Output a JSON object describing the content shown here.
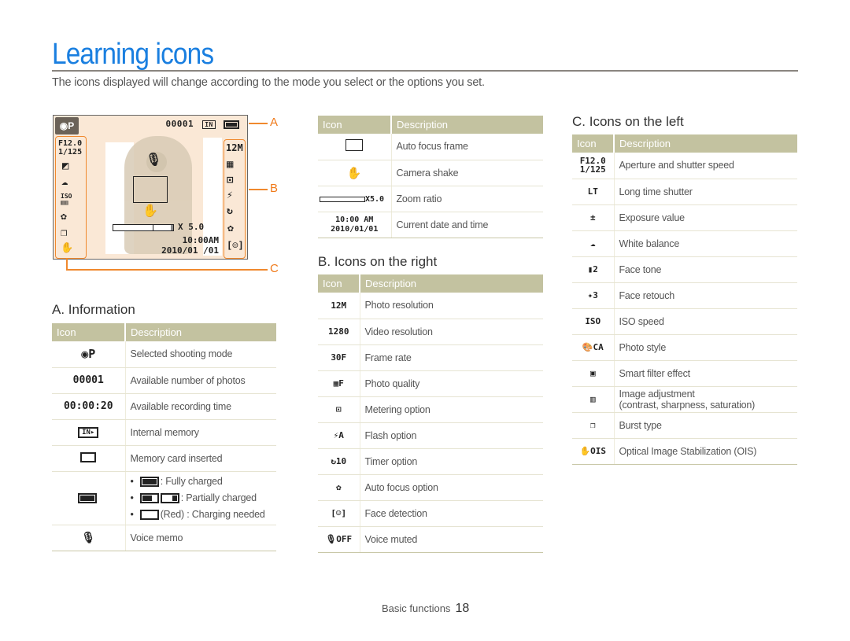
{
  "page": {
    "title": "Learning icons",
    "subtitle": "The icons displayed will change according to the mode you select or the options you set.",
    "accent_color": "#1a7fe0",
    "callout_color": "#f0892e",
    "table_header_color": "#c3c2a0"
  },
  "screen": {
    "mode_icon": "camera-program-icon",
    "photo_count": "00001",
    "memory": "IN",
    "aperture": "F12.0",
    "shutter": "1/125",
    "zoom": "X 5.0",
    "time": "10:00AM",
    "date": "2010/01 /01",
    "res": "12M",
    "labels": {
      "a": "A",
      "b": "B",
      "c": "C"
    }
  },
  "section_a": {
    "title": "A. Information",
    "header": {
      "icon": "Icon",
      "description": "Description"
    },
    "rows": [
      {
        "icon": "camera-program-icon",
        "icon_text": "📷P",
        "description": "Selected shooting mode"
      },
      {
        "icon": "photo-count-icon",
        "icon_text": "00001",
        "description": "Available number of photos"
      },
      {
        "icon": "recording-time-icon",
        "icon_text": "00:00:20",
        "description": "Available recording time"
      },
      {
        "icon": "internal-memory-icon",
        "icon_text": "IN▸",
        "description": "Internal memory"
      },
      {
        "icon": "memory-card-icon",
        "icon_text": "",
        "description": "Memory card inserted"
      },
      {
        "icon": "battery-icon",
        "icon_text": "",
        "bullets": [
          {
            "text": ": Fully charged",
            "level": "full"
          },
          {
            "text": ": Partially charged",
            "level": "partial"
          },
          {
            "text": "(Red) : Charging needed",
            "level": "empty"
          }
        ]
      },
      {
        "icon": "voice-memo-icon",
        "icon_text": "🎙",
        "description": "Voice memo"
      }
    ]
  },
  "section_top_mid": {
    "header": {
      "icon": "Icon",
      "description": "Description"
    },
    "rows": [
      {
        "icon": "af-frame-icon",
        "icon_text": "",
        "description": "Auto focus frame"
      },
      {
        "icon": "camera-shake-icon",
        "icon_text": "✋",
        "description": "Camera shake"
      },
      {
        "icon": "zoom-ratio-icon",
        "icon_text": "X5.0",
        "description": "Zoom ratio"
      },
      {
        "icon": "date-time-icon",
        "icon_text": "10:00 AM\n2010/01/01",
        "description": "Current date and time"
      }
    ]
  },
  "section_b": {
    "title": "B. Icons on the right",
    "header": {
      "icon": "Icon",
      "description": "Description"
    },
    "rows": [
      {
        "icon": "photo-resolution-icon",
        "icon_text": "12M",
        "description": "Photo resolution"
      },
      {
        "icon": "video-resolution-icon",
        "icon_text": "1280",
        "description": "Video resolution"
      },
      {
        "icon": "frame-rate-icon",
        "icon_text": "30F",
        "description": "Frame rate"
      },
      {
        "icon": "photo-quality-icon",
        "icon_text": "▦F",
        "description": "Photo quality"
      },
      {
        "icon": "metering-icon",
        "icon_text": "⊡",
        "description": "Metering option"
      },
      {
        "icon": "flash-icon",
        "icon_text": "⚡A",
        "description": "Flash option"
      },
      {
        "icon": "timer-icon",
        "icon_text": "↻10",
        "description": "Timer option"
      },
      {
        "icon": "auto-focus-macro-icon",
        "icon_text": "✿",
        "description": "Auto focus option"
      },
      {
        "icon": "face-detection-icon",
        "icon_text": "[☺]",
        "description": "Face detection"
      },
      {
        "icon": "voice-muted-icon",
        "icon_text": "🎙OFF",
        "description": "Voice muted"
      }
    ]
  },
  "section_c": {
    "title": "C. Icons on the left",
    "header": {
      "icon": "Icon",
      "description": "Description"
    },
    "rows": [
      {
        "icon": "aperture-shutter-icon",
        "icon_text": "F12.0\n1/125",
        "description": "Aperture and shutter speed"
      },
      {
        "icon": "long-time-shutter-icon",
        "icon_text": "LT",
        "description": "Long time shutter"
      },
      {
        "icon": "exposure-value-icon",
        "icon_text": "±",
        "description": "Exposure value"
      },
      {
        "icon": "white-balance-icon",
        "icon_text": "☁",
        "description": "White balance"
      },
      {
        "icon": "face-tone-icon",
        "icon_text": "▮2",
        "description": "Face tone"
      },
      {
        "icon": "face-retouch-icon",
        "icon_text": "✦3",
        "description": "Face retouch"
      },
      {
        "icon": "iso-speed-icon",
        "icon_text": "ISO",
        "description": "ISO speed"
      },
      {
        "icon": "photo-style-icon",
        "icon_text": "🎨CA",
        "description": "Photo style"
      },
      {
        "icon": "smart-filter-icon",
        "icon_text": "▣",
        "description": "Smart filter effect"
      },
      {
        "icon": "image-adjustment-icon",
        "icon_text": "▥",
        "description": "Image adjustment",
        "description2": "(contrast, sharpness, saturation)"
      },
      {
        "icon": "burst-type-icon",
        "icon_text": "❐",
        "description": "Burst type"
      },
      {
        "icon": "ois-icon",
        "icon_text": "✋OIS",
        "description": "Optical Image Stabilization (OIS)"
      }
    ]
  },
  "footer": {
    "section": "Basic functions",
    "page_number": "18"
  }
}
